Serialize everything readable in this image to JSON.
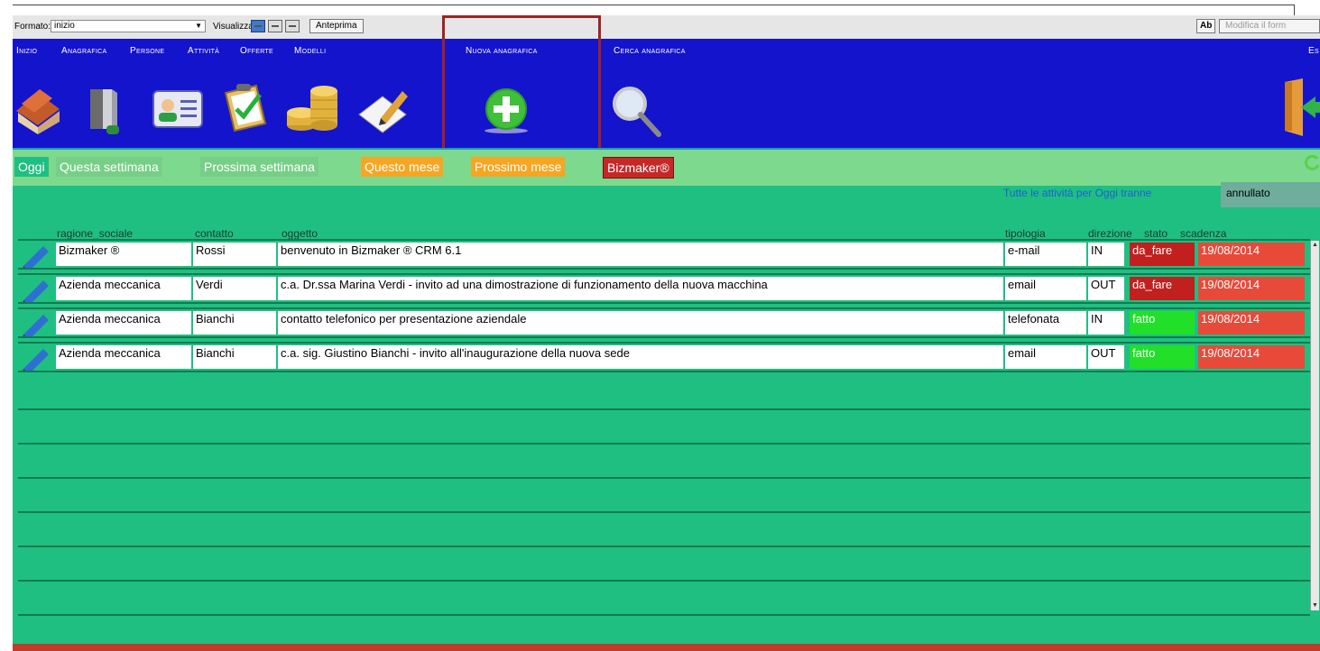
{
  "toolbar": {
    "formato_label": "Formato:",
    "formato_value": "inizio",
    "visualizza_label": "Visualizza:",
    "anteprima_label": "Anteprima",
    "ab_label": "Ab",
    "modifica_label": "Modifica il form"
  },
  "menu": {
    "inizio": "Inizio",
    "anagrafica": "Anagrafica",
    "persone": "Persone",
    "attivita": "Attività",
    "offerte": "Offerte",
    "modelli": "Modelli",
    "nuova_anagrafica": "Nuova anagrafica",
    "cerca_anagrafica": "Cerca anagrafica",
    "esci": "Es"
  },
  "tabs": [
    {
      "label": "Oggi",
      "color": "#1fbf82",
      "text_color": "#ffffff"
    },
    {
      "label": "Questa settimana",
      "color": "#7dd98e",
      "text_color": "#ffffff"
    },
    {
      "label": "Prossima settimana",
      "color": "#7dd98e",
      "text_color": "#ffffff"
    },
    {
      "label": "Questo mese",
      "color": "#f5a623",
      "text_color": "#ffffff"
    },
    {
      "label": "Prossimo mese",
      "color": "#f5a623",
      "text_color": "#ffffff"
    },
    {
      "label": "Bizmaker®",
      "color": "#c62828",
      "text_color": "#ffffff"
    }
  ],
  "filter": {
    "text": "Tutte le attività per Oggi tranne",
    "value": "annullato"
  },
  "columns": {
    "ragione_sociale": "ragione_sociale",
    "contatto": "contatto",
    "oggetto": "oggetto",
    "tipologia": "tipologia",
    "direzione": "direzione",
    "stato": "stato",
    "scadenza": "scadenza"
  },
  "rows": [
    {
      "ragione_sociale": "Bizmaker ®",
      "contatto": "Rossi",
      "oggetto": "benvenuto in Bizmaker ® CRM 6.1",
      "tipologia": "e-mail",
      "direzione": "IN",
      "stato": "da_fare",
      "scadenza": "19/08/2014"
    },
    {
      "ragione_sociale": "Azienda meccanica",
      "contatto": "Verdi",
      "oggetto": "c.a. Dr.ssa  Marina Verdi - invito ad una dimostrazione di funzionamento della nuova macchina",
      "tipologia": "email",
      "direzione": "OUT",
      "stato": "da_fare",
      "scadenza": "19/08/2014"
    },
    {
      "ragione_sociale": "Azienda meccanica",
      "contatto": "Bianchi",
      "oggetto": "contatto telefonico per presentazione aziendale",
      "tipologia": "telefonata",
      "direzione": "IN",
      "stato": "fatto",
      "scadenza": "19/08/2014"
    },
    {
      "ragione_sociale": "Azienda meccanica",
      "contatto": "Bianchi",
      "oggetto": "c.a. sig. Giustino Bianchi - invito all'inaugurazione della nuova sede",
      "tipologia": "email",
      "direzione": "OUT",
      "stato": "fatto",
      "scadenza": "19/08/2014"
    }
  ],
  "colors": {
    "ribbon": "#1414cd",
    "grid_bg": "#1fbf82",
    "da_fare": "#c21f1f",
    "fatto": "#22e02a",
    "scadenza": "#e84a3a",
    "highlight": "#9e2323"
  }
}
